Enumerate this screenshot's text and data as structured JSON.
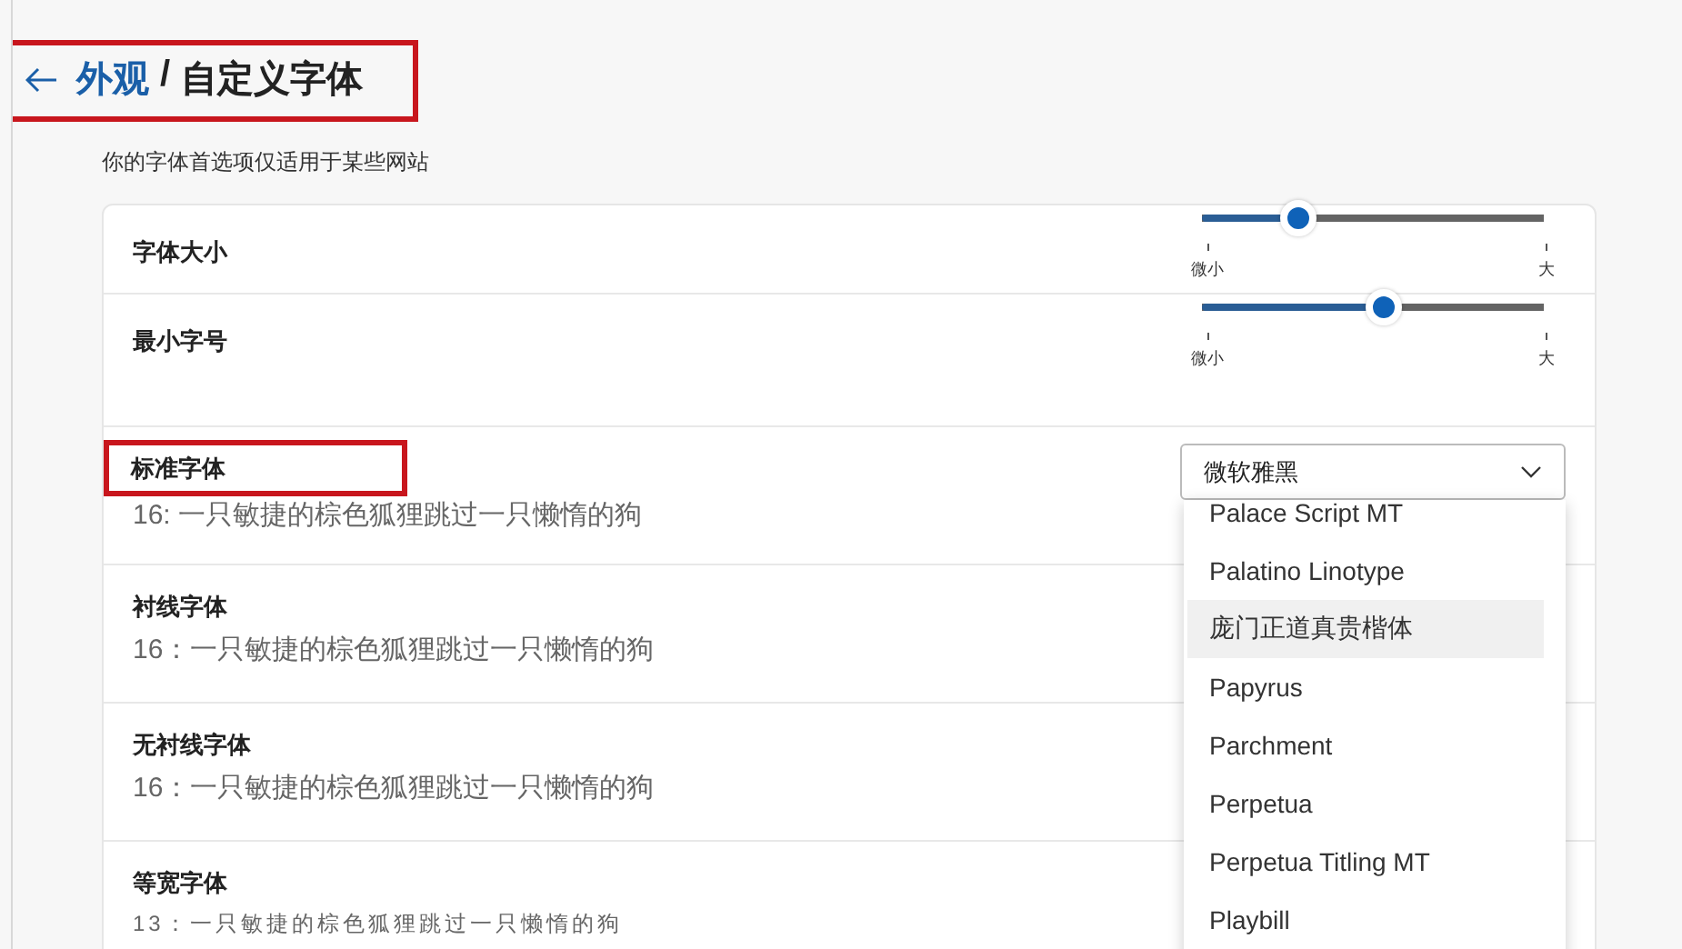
{
  "header": {
    "parent": "外观",
    "separator": "/",
    "title": "自定义字体",
    "highlighted": true
  },
  "description": "你的字体首选项仅适用于某些网站",
  "size_settings": [
    {
      "label": "字体大小",
      "level": 0.28,
      "min_label": "微小",
      "max_label": "大"
    },
    {
      "label": "最小字号",
      "level": 0.53,
      "min_label": "微小",
      "max_label": "大"
    }
  ],
  "font_settings": [
    {
      "label": "标准字体",
      "sample": "16: 一只敏捷的棕色狐狸跳过一只懒惰的狗",
      "kind": "standard",
      "highlighted": true
    },
    {
      "label": "衬线字体",
      "sample": "16：一只敏捷的棕色狐狸跳过一只懒惰的狗",
      "kind": "standard",
      "highlighted": false
    },
    {
      "label": "无衬线字体",
      "sample": "16：一只敏捷的棕色狐狸跳过一只懒惰的狗",
      "kind": "standard",
      "highlighted": false
    },
    {
      "label": "等宽字体",
      "sample": "13：一只敏捷的棕色狐狸跳过一只懒惰的狗",
      "kind": "mono",
      "highlighted": false
    }
  ],
  "standard_font_dropdown": {
    "value": "微软雅黑",
    "expanded": true,
    "options": [
      {
        "label": "Palace Script MT",
        "selected": false
      },
      {
        "label": "Palatino Linotype",
        "selected": false
      },
      {
        "label": "庞门正道真贵楷体",
        "selected": true
      },
      {
        "label": "Papyrus",
        "selected": false
      },
      {
        "label": "Parchment",
        "selected": false
      },
      {
        "label": "Perpetua",
        "selected": false
      },
      {
        "label": "Perpetua Titling MT",
        "selected": false
      },
      {
        "label": "Playbill",
        "selected": false
      }
    ]
  }
}
